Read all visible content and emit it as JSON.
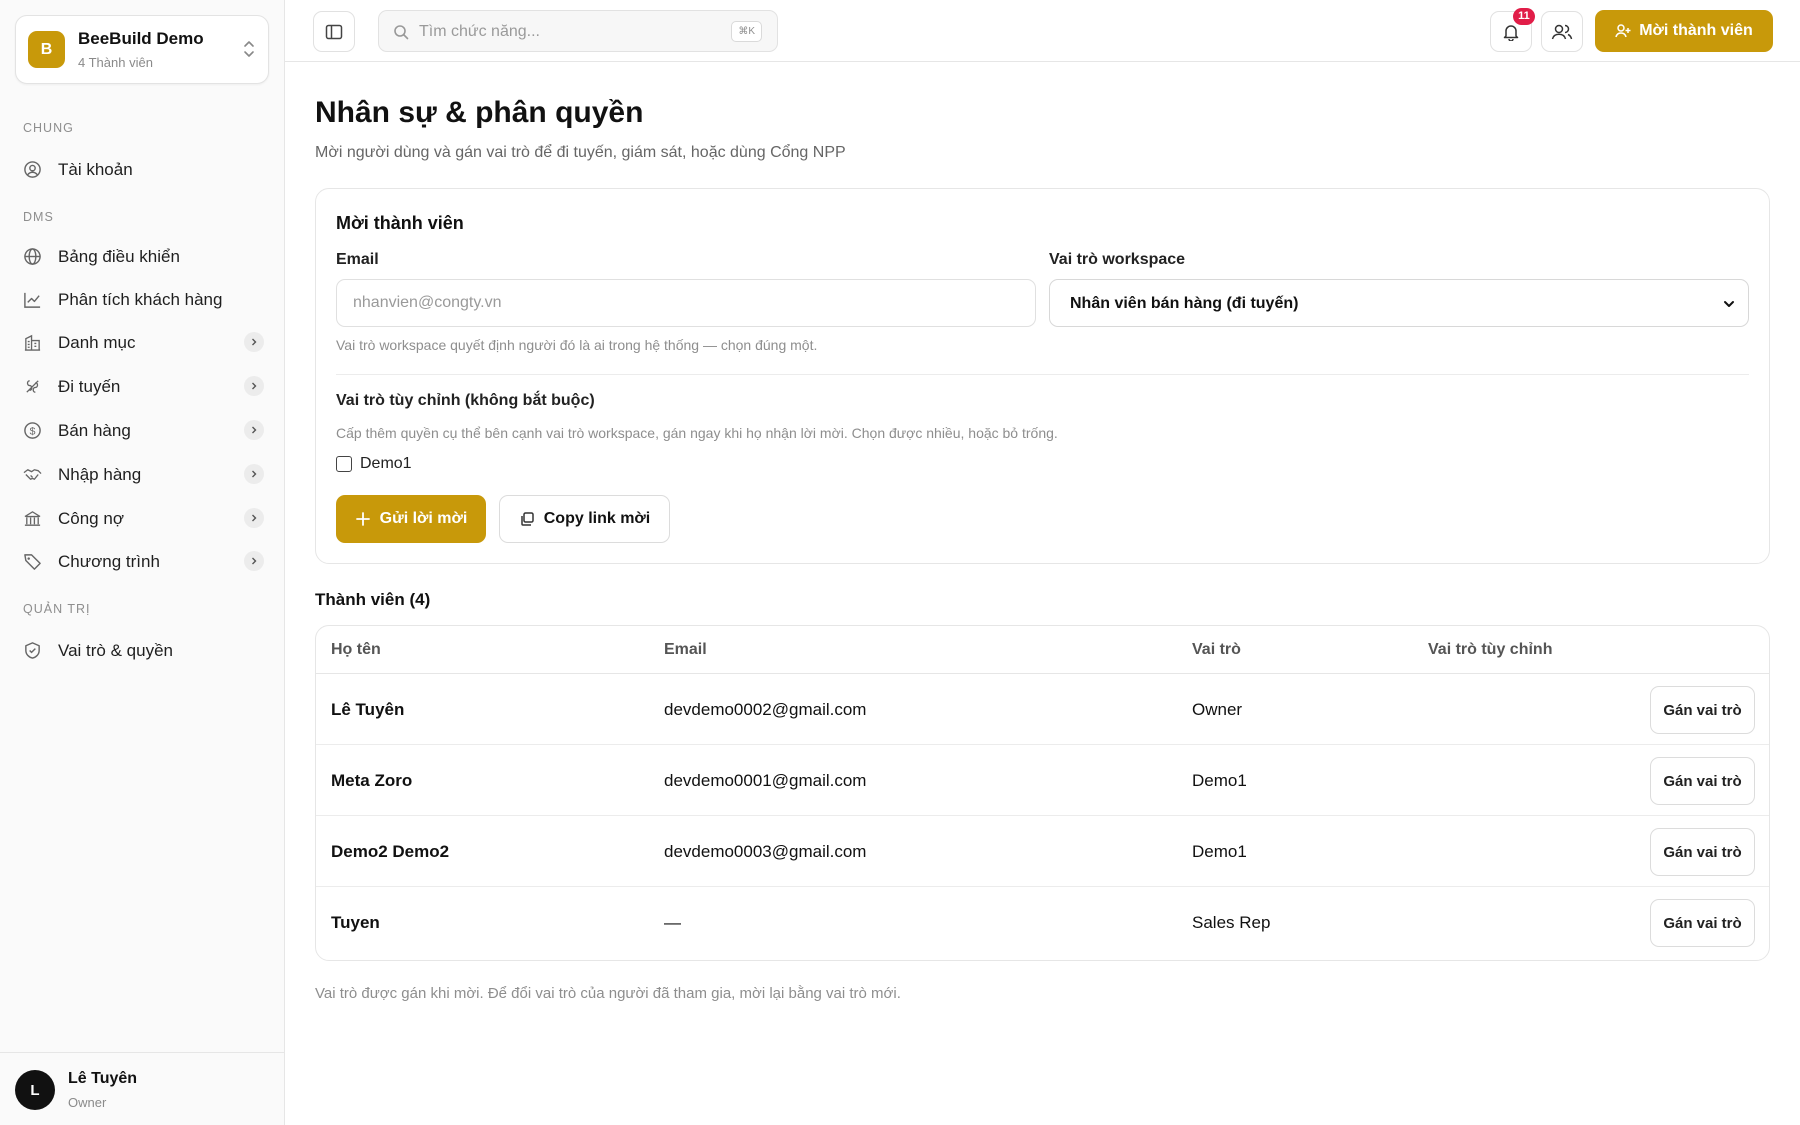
{
  "workspace": {
    "logo_letter": "B",
    "name": "BeeBuild Demo",
    "members": "4 Thành viên"
  },
  "sidebar": {
    "section_general": "CHUNG",
    "section_dms": "DMS",
    "section_admin": "QUẢN TRỊ",
    "items": [
      {
        "label": "Tài khoản",
        "icon": "user-circle-icon"
      },
      {
        "label": "Bảng điều khiển",
        "icon": "globe-icon"
      },
      {
        "label": "Phân tích khách hàng",
        "icon": "trend-chart-icon"
      },
      {
        "label": "Danh mục",
        "icon": "building-icon",
        "expandable": true
      },
      {
        "label": "Đi tuyến",
        "icon": "route-icon",
        "expandable": true
      },
      {
        "label": "Bán hàng",
        "icon": "dollar-circle-icon",
        "expandable": true
      },
      {
        "label": "Nhập hàng",
        "icon": "handshake-icon",
        "expandable": true
      },
      {
        "label": "Công nợ",
        "icon": "bank-icon",
        "expandable": true
      },
      {
        "label": "Chương trình",
        "icon": "tag-icon",
        "expandable": true
      },
      {
        "label": "Vai trò & quyền",
        "icon": "shield-check-icon"
      }
    ]
  },
  "user": {
    "avatar_letter": "L",
    "name": "Lê Tuyên",
    "role": "Owner"
  },
  "topbar": {
    "search_placeholder": "Tìm chức năng...",
    "search_shortcut": "⌘K",
    "notification_count": "11",
    "invite_label": "Mời thành viên"
  },
  "page": {
    "title": "Nhân sự & phân quyền",
    "description": "Mời người dùng và gán vai trò để đi tuyến, giám sát, hoặc dùng Cổng NPP"
  },
  "invite_form": {
    "title": "Mời thành viên",
    "email_label": "Email",
    "email_placeholder": "nhanvien@congty.vn",
    "email_value": "",
    "role_label": "Vai trò workspace",
    "role_value": "Nhân viên bán hàng (đi tuyến)",
    "role_hint": "Vai trò workspace quyết định người đó là ai trong hệ thống — chọn đúng một.",
    "custom_role_title": "Vai trò tùy chỉnh (không bắt buộc)",
    "custom_role_hint": "Cấp thêm quyền cụ thể bên cạnh vai trò workspace, gán ngay khi họ nhận lời mời. Chọn được nhiều, hoặc bỏ trống.",
    "custom_role_option": "Demo1",
    "custom_role_checked": false,
    "send_label": "Gửi lời mời",
    "copy_label": "Copy link mời"
  },
  "members": {
    "title": "Thành viên (4)",
    "columns": [
      "Họ tên",
      "Email",
      "Vai trò",
      "Vai trò tùy chỉnh"
    ],
    "action_label": "Gán vai trò",
    "rows": [
      {
        "name": "Lê Tuyên",
        "email": "devdemo0002@gmail.com",
        "role": "Owner",
        "custom": ""
      },
      {
        "name": "Meta Zoro",
        "email": "devdemo0001@gmail.com",
        "role": "Demo1",
        "custom": ""
      },
      {
        "name": "Demo2 Demo2",
        "email": "devdemo0003@gmail.com",
        "role": "Demo1",
        "custom": ""
      },
      {
        "name": "Tuyen",
        "email": "—",
        "role": "Sales Rep",
        "custom": ""
      }
    ],
    "footnote": "Vai trò được gán khi mời. Để đổi vai trò của người đã tham gia, mời lại bằng vai trò mới."
  },
  "colors": {
    "accent": "#c8990a",
    "badge": "#e11d48"
  }
}
